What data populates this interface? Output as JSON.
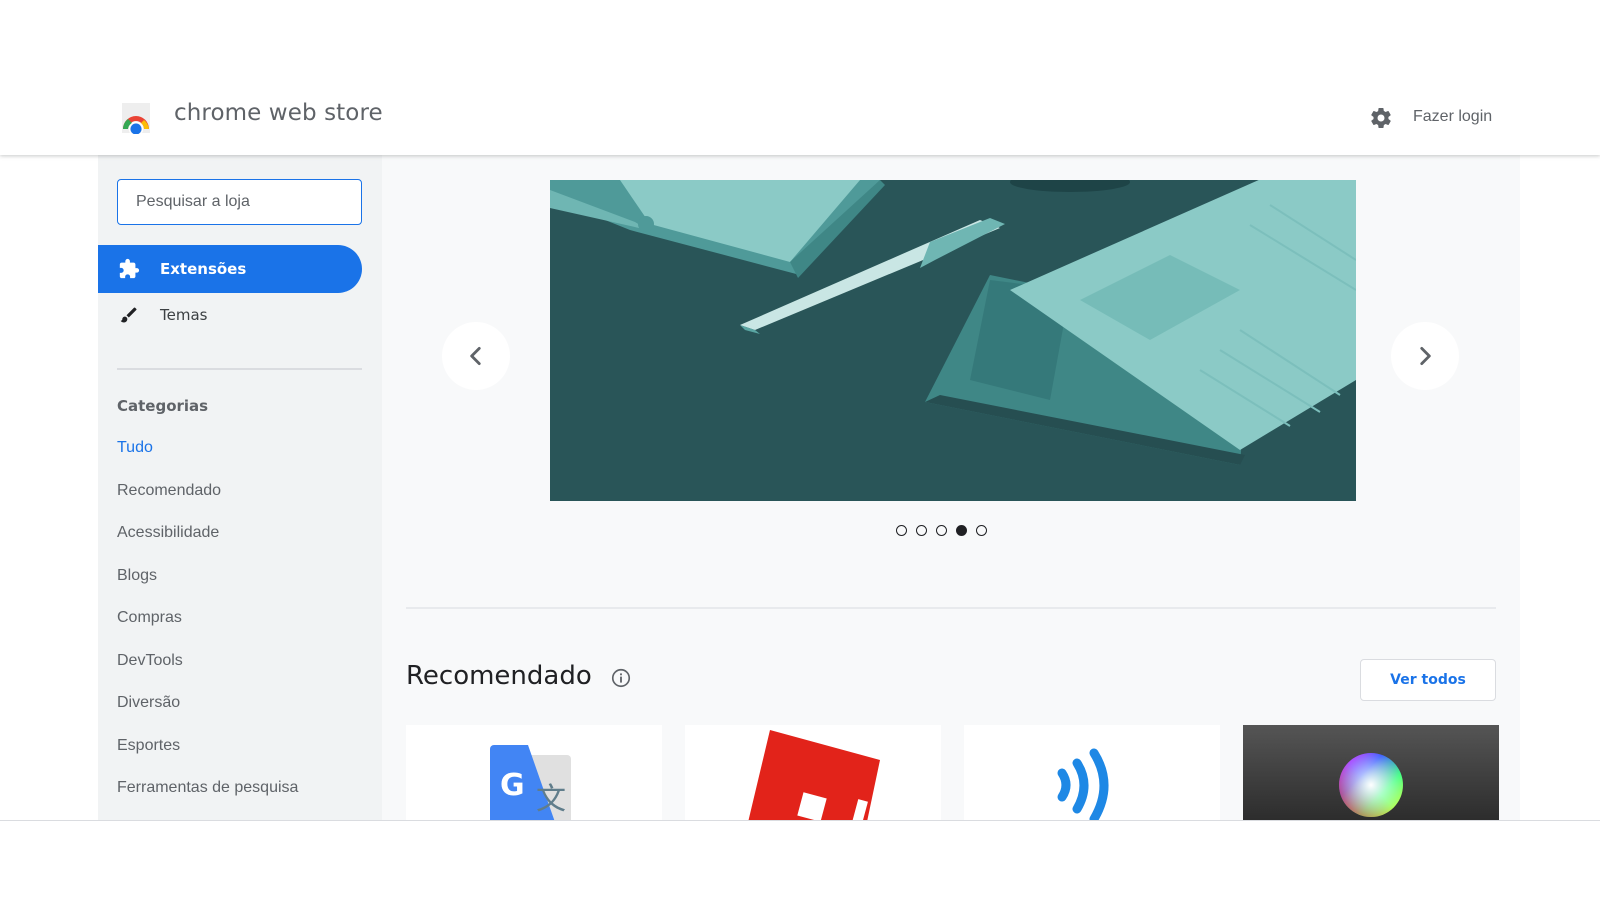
{
  "header": {
    "brand": "chrome web store",
    "settings_icon": "gear-icon",
    "login_label": "Fazer login"
  },
  "sidebar": {
    "search": {
      "placeholder": "Pesquisar a loja",
      "value": ""
    },
    "nav": [
      {
        "label": "Extensões",
        "icon": "puzzle-piece-icon",
        "active": true
      },
      {
        "label": "Temas",
        "icon": "paintbrush-icon",
        "active": false
      }
    ],
    "categories_heading": "Categorias",
    "categories": [
      {
        "label": "Tudo",
        "selected": true
      },
      {
        "label": "Recomendado"
      },
      {
        "label": "Acessibilidade"
      },
      {
        "label": "Blogs"
      },
      {
        "label": "Compras"
      },
      {
        "label": "DevTools"
      },
      {
        "label": "Diversão"
      },
      {
        "label": "Esportes"
      },
      {
        "label": "Ferramentas de pesquisa"
      }
    ]
  },
  "carousel": {
    "prev_icon": "chevron-left-icon",
    "next_icon": "chevron-right-icon",
    "slide_count": 5,
    "active_slide": 4
  },
  "recommended": {
    "title": "Recomendado",
    "info_icon": "info-icon",
    "see_all_label": "Ver todos",
    "items": [
      {
        "icon": "google-translate-icon"
      },
      {
        "icon": "roblox-icon"
      },
      {
        "icon": "sound-waves-icon"
      },
      {
        "icon": "color-wheel-icon"
      }
    ]
  },
  "colors": {
    "accent": "#1a73e8",
    "sidebar_bg": "#f1f3f4",
    "banner_bg": "#295558"
  }
}
